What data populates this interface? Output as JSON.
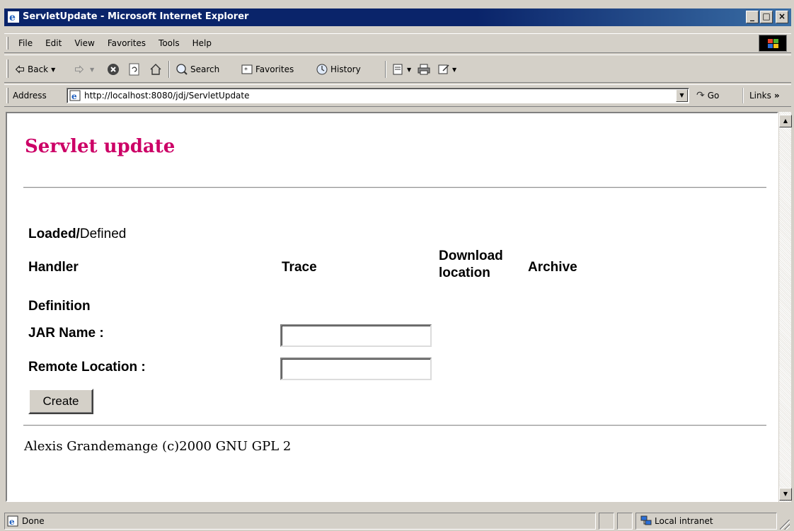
{
  "window": {
    "title": "ServletUpdate - Microsoft Internet Explorer",
    "buttons": {
      "minimize": "_",
      "maximize": "□",
      "close": "×"
    }
  },
  "menu": [
    "File",
    "Edit",
    "View",
    "Favorites",
    "Tools",
    "Help"
  ],
  "toolbar": {
    "back_label": "Back",
    "search_label": "Search",
    "favorites_label": "Favorites",
    "history_label": "History"
  },
  "address": {
    "label": "Address",
    "url": "http://localhost:8080/jdj/ServletUpdate",
    "go_label": "Go",
    "links_label": "Links"
  },
  "page": {
    "title": "Servlet update",
    "loaded_label": "Loaded/",
    "defined_label": "Defined",
    "columns": {
      "handler": "Handler",
      "trace": "Trace",
      "download_line1": "Download",
      "download_line2": "location",
      "archive": "Archive"
    },
    "definition_heading": "Definition",
    "jar_name_label": "JAR Name :",
    "jar_name_value": "",
    "remote_location_label": "Remote Location :",
    "remote_location_value": "",
    "create_button": "Create",
    "footer": "Alexis Grandemange (c)2000 GNU GPL 2"
  },
  "status": {
    "text": "Done",
    "zone": "Local intranet"
  },
  "colors": {
    "title_bar": "#0a246a",
    "page_title": "#cc0066",
    "chrome": "#d4d0c8"
  }
}
